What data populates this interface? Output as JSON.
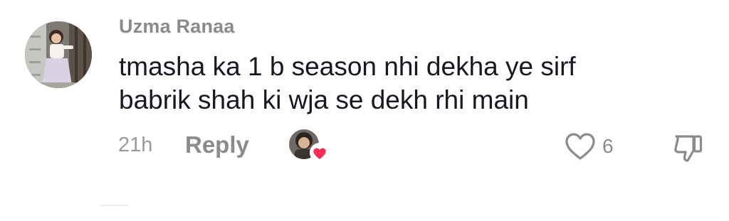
{
  "comment": {
    "author": "Uzma Ranaa",
    "text_lines": [
      "tmasha ka 1 b season nhi dekha ye sirf",
      "babrik shah ki wja se dekh rhi main"
    ],
    "timestamp": "21h",
    "reply_label": "Reply",
    "like_count": "6",
    "liked_by_creator": true,
    "icons": {
      "like": "heart-outline-icon",
      "dislike": "thumbs-down-icon",
      "creator_badge": "heart-filled-icon"
    },
    "colors": {
      "text": "#161823",
      "muted": "#8b8b8b",
      "heart_badge": "#fe2c55"
    }
  }
}
